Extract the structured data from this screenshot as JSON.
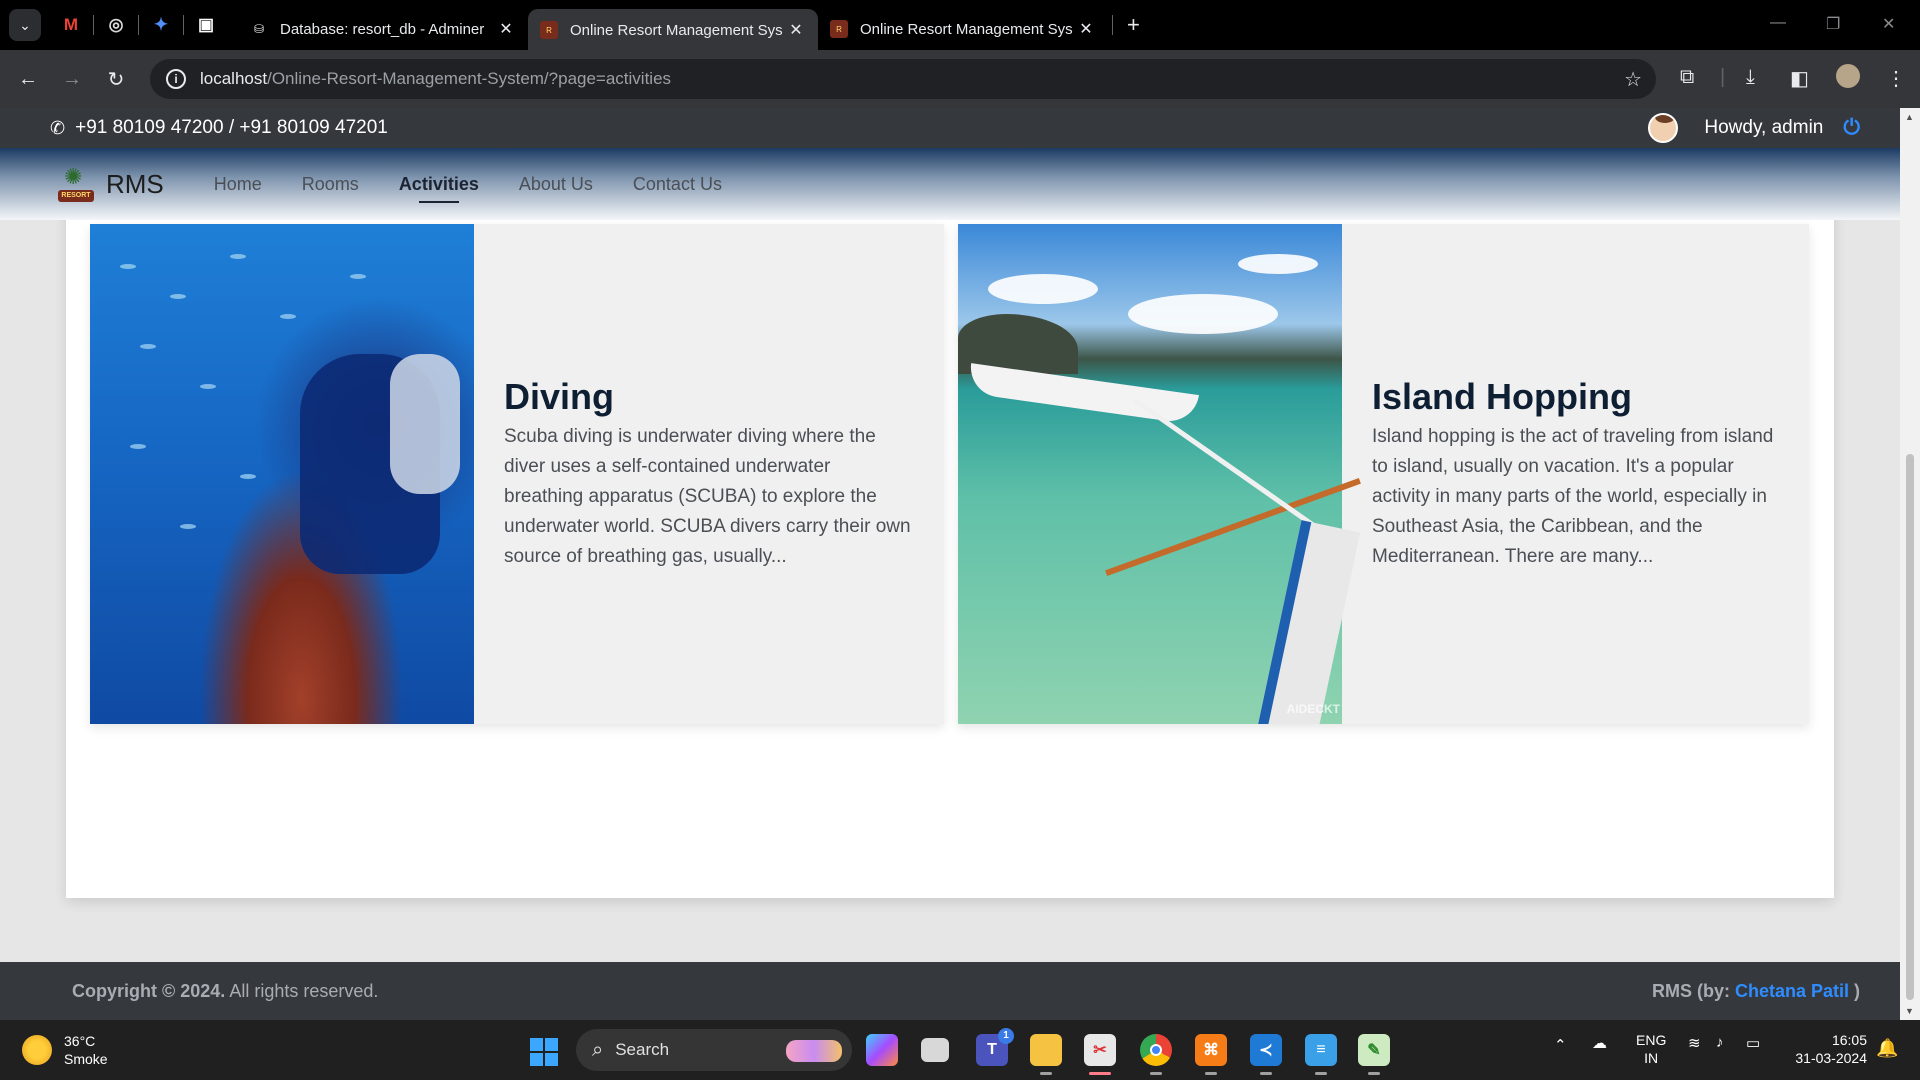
{
  "browser": {
    "tabs": [
      {
        "title": "Database: resort_db - Adminer",
        "active": false
      },
      {
        "title": "Online Resort Management Sys",
        "active": true
      },
      {
        "title": "Online Resort Management Sys",
        "active": false
      }
    ],
    "url_host": "localhost",
    "url_path": "/Online-Resort-Management-System/?page=activities"
  },
  "topbar": {
    "phone": "+91 80109 47200 / +91 80109 47201",
    "greeting": "Howdy, admin"
  },
  "navbar": {
    "brand": "RMS",
    "logo_text": "RESORT",
    "links": [
      {
        "label": "Home",
        "active": false
      },
      {
        "label": "Rooms",
        "active": false
      },
      {
        "label": "Activities",
        "active": true
      },
      {
        "label": "About Us",
        "active": false
      },
      {
        "label": "Contact Us",
        "active": false
      }
    ]
  },
  "activities": [
    {
      "title": "Diving",
      "description": "Scuba diving is underwater diving where the diver uses a self-contained underwater breathing apparatus (SCUBA) to explore the underwater world. SCUBA divers carry their own source of breathing gas, usually..."
    },
    {
      "title": "Island Hopping",
      "description": "Island hopping is the act of traveling from island to island, usually on vacation. It's a popular activity in many parts of the world, especially in Southeast Asia, the Caribbean, and the Mediterranean. There are many...",
      "image_watermark": "AIDECKT"
    }
  ],
  "footer": {
    "copyright_bold": "Copyright © 2024.",
    "copyright_rest": " All rights reserved.",
    "credit_prefix": "RMS (by: ",
    "credit_author": "Chetana Patil",
    "credit_suffix": " )"
  },
  "taskbar": {
    "temperature": "36°C",
    "condition": "Smoke",
    "search_label": "Search",
    "teams_badge": "1",
    "lang_top": "ENG",
    "lang_bottom": "IN",
    "time": "16:05",
    "date": "31-03-2024"
  },
  "colors": {
    "accent_blue": "#2f8cff",
    "topbar_bg": "#35383d",
    "heading": "#0f1f33"
  }
}
